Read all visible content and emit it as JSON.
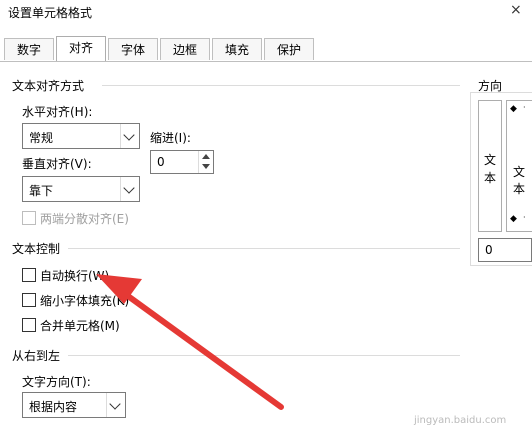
{
  "window": {
    "title": "设置单元格格式",
    "close_label": "×"
  },
  "tabs": [
    {
      "label": "数字"
    },
    {
      "label": "对齐"
    },
    {
      "label": "字体"
    },
    {
      "label": "边框"
    },
    {
      "label": "填充"
    },
    {
      "label": "保护"
    }
  ],
  "alignment": {
    "section": "文本对齐方式",
    "horizontal_label": "水平对齐(H):",
    "horizontal_value": "常规",
    "indent_label": "缩进(I):",
    "indent_value": "0",
    "vertical_label": "垂直对齐(V):",
    "vertical_value": "靠下",
    "distributed_label": "两端分散对齐(E)"
  },
  "text_control": {
    "section": "文本控制",
    "wrap_label": "自动换行(W)",
    "shrink_label": "缩小字体填充(K)",
    "merge_label": "合并单元格(M)"
  },
  "rtl": {
    "section": "从右到左",
    "direction_label": "文字方向(T):",
    "direction_value": "根据内容"
  },
  "orientation": {
    "section": "方向",
    "vertical_text": [
      "文",
      "本"
    ],
    "horizontal_text": "文本",
    "degree_value": "0"
  },
  "watermark": "jingyan.baidu.com",
  "colors": {
    "arrow": "#e53935",
    "accent": "#0078d7"
  }
}
